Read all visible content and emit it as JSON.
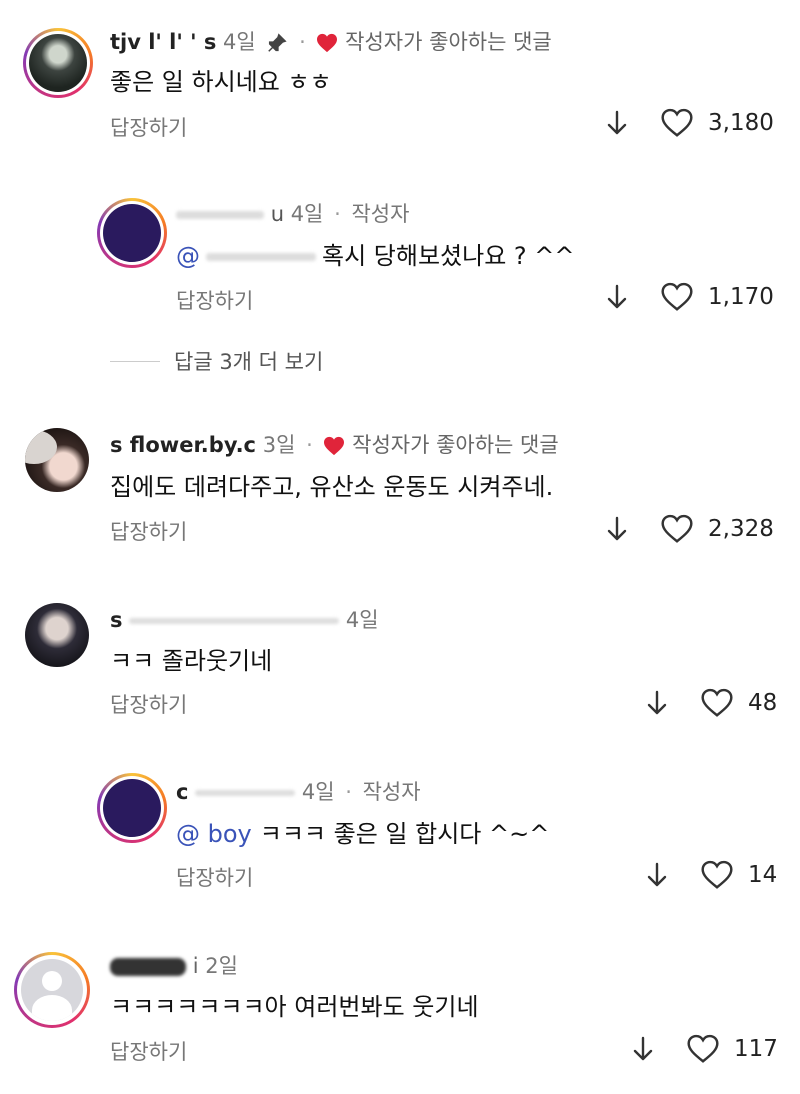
{
  "comments": [
    {
      "username": "tjv     l' l' ' s",
      "time": "4일",
      "liked_by_author": "작성자가 좋아하는 댓글",
      "text": "좋은 일 하시네요 ㅎㅎ",
      "reply_label": "답장하기",
      "likes": "3,180"
    },
    {
      "username": "u",
      "time": "4일",
      "author_badge": "작성자",
      "mention": "@",
      "text": "혹시 당해보셨나요 ? ^^",
      "reply_label": "답장하기",
      "likes": "1,170"
    },
    {
      "more_replies": "답글 3개 더 보기"
    },
    {
      "username": "s        flower.by.c",
      "time": "3일",
      "liked_by_author": "작성자가 좋아하는 댓글",
      "text": "집에도 데려다주고, 유산소 운동도 시켜주네.",
      "reply_label": "답장하기",
      "likes": "2,328"
    },
    {
      "username": "s",
      "time": "4일",
      "text": "ㅋㅋ 졸라웃기네",
      "reply_label": "답장하기",
      "likes": "48"
    },
    {
      "username": "c",
      "time": "4일",
      "author_badge": "작성자",
      "mention": "@              boy",
      "text": "ㅋㅋㅋ 좋은 일 합시다 ^~^",
      "reply_label": "답장하기",
      "likes": "14"
    },
    {
      "username": "i",
      "time": "2일",
      "text": "ㅋㅋㅋㅋㅋㅋㅋ아 여러번봐도 웃기네",
      "reply_label": "답장하기",
      "likes": "117"
    }
  ],
  "colors": {
    "heart_liked": "#e0243a",
    "mention": "#3a53b8",
    "ring": "instagram-gradient"
  }
}
